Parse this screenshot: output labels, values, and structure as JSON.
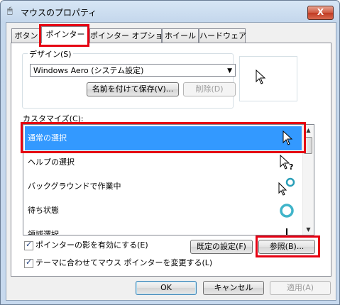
{
  "window": {
    "title": "マウスのプロパティ",
    "close_glyph": "X"
  },
  "tabs": [
    {
      "label": "ボタン"
    },
    {
      "label": "ポインター"
    },
    {
      "label": "ポインター オプション"
    },
    {
      "label": "ホイール"
    },
    {
      "label": "ハードウェア"
    }
  ],
  "active_tab": "ポインター",
  "scheme": {
    "group_label": "デザイン(S)",
    "selected": "Windows Aero (システム設定)",
    "save_as_label": "名前を付けて保存(V)...",
    "delete_label": "削除(D)"
  },
  "customize": {
    "label": "カスタマイズ(C):",
    "items": [
      {
        "label": "通常の選択",
        "icon": "arrow-cursor-icon",
        "selected": true
      },
      {
        "label": "ヘルプの選択",
        "icon": "help-cursor-icon",
        "selected": false
      },
      {
        "label": "バックグラウンドで作業中",
        "icon": "working-in-background-cursor-icon",
        "selected": false
      },
      {
        "label": "待ち状態",
        "icon": "busy-cursor-icon",
        "selected": false
      },
      {
        "label": "領域選択",
        "icon": "precision-select-cursor-icon",
        "selected": false
      }
    ]
  },
  "options": {
    "shadow_label": "ポインターの影を有効にする(E)",
    "shadow_checked": true,
    "theme_label": "テーマに合わせてマウス ポインターを変更する(L)",
    "theme_checked": true,
    "default_label": "既定の設定(F)",
    "browse_label": "参照(B)..."
  },
  "footer": {
    "ok_label": "OK",
    "cancel_label": "キャンセル",
    "apply_label": "適用(A)"
  },
  "colors": {
    "highlight_box": "#e60012",
    "selection": "#3399ff"
  }
}
